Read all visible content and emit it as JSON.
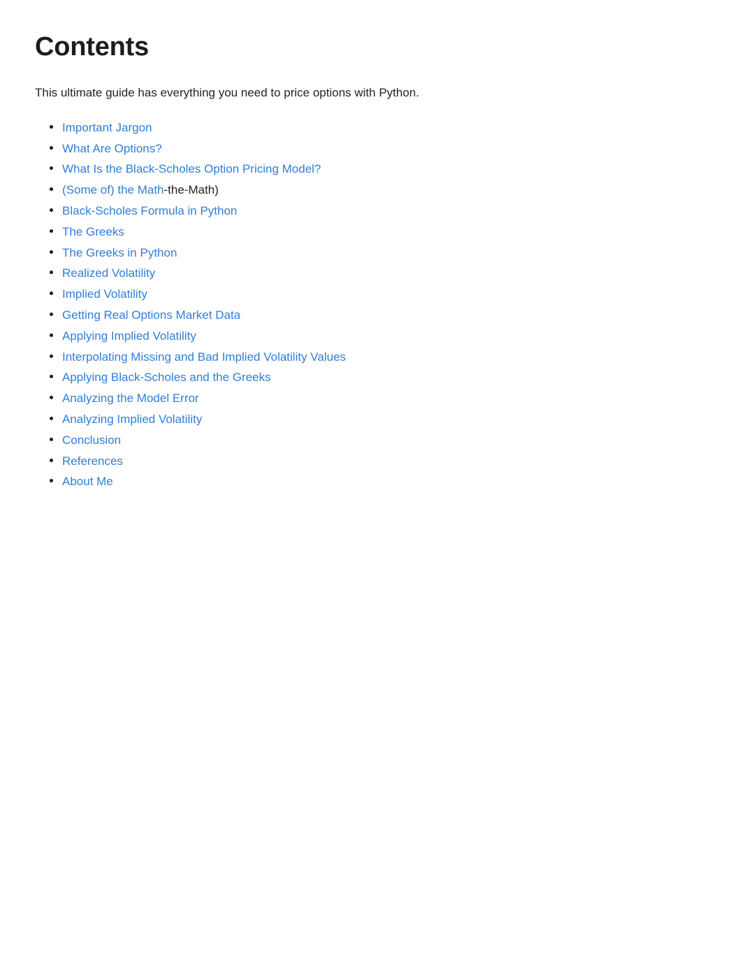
{
  "page": {
    "title": "Contents",
    "intro": "This ultimate guide has everything you need to price options with Python.",
    "background_color": "#ffffff",
    "text_color": "#242424",
    "heading_color": "#1d1d1d",
    "link_color": "#2f7ed8",
    "bullet_color": "#1a1a1a"
  },
  "toc": {
    "items": [
      {
        "label": "Important Jargon",
        "suffix": ""
      },
      {
        "label": "What Are Options?",
        "suffix": ""
      },
      {
        "label": "What Is the Black-Scholes Option Pricing Model?",
        "suffix": ""
      },
      {
        "label": "(Some of) the Math",
        "suffix": "-the-Math)"
      },
      {
        "label": "Black-Scholes Formula in Python",
        "suffix": ""
      },
      {
        "label": "The Greeks",
        "suffix": ""
      },
      {
        "label": "The Greeks in Python",
        "suffix": ""
      },
      {
        "label": "Realized Volatility",
        "suffix": ""
      },
      {
        "label": "Implied Volatility",
        "suffix": ""
      },
      {
        "label": "Getting Real Options Market Data",
        "suffix": ""
      },
      {
        "label": "Applying Implied Volatility",
        "suffix": ""
      },
      {
        "label": "Interpolating Missing and Bad Implied Volatility Values",
        "suffix": ""
      },
      {
        "label": "Applying Black-Scholes and the Greeks",
        "suffix": ""
      },
      {
        "label": "Analyzing the Model Error",
        "suffix": ""
      },
      {
        "label": "Analyzing Implied Volatility",
        "suffix": ""
      },
      {
        "label": "Conclusion",
        "suffix": ""
      },
      {
        "label": "References",
        "suffix": ""
      },
      {
        "label": "About Me",
        "suffix": ""
      }
    ]
  }
}
